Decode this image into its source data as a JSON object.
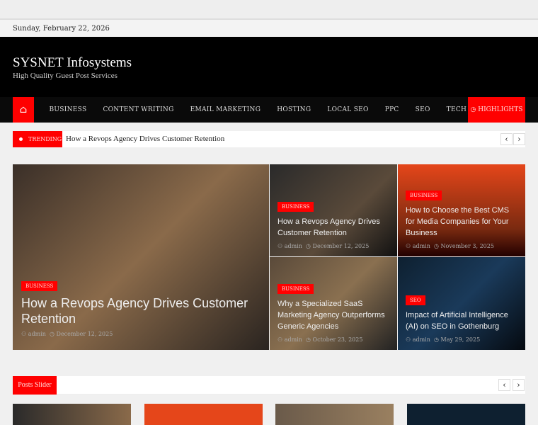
{
  "date": "Sunday, February 22, 2026",
  "site": {
    "title": "SYSNET Infosystems",
    "tagline": "High Quality Guest Post Services"
  },
  "nav": {
    "home_icon": "home-icon",
    "items": [
      "BUSINESS",
      "CONTENT WRITING",
      "EMAIL MARKETING",
      "HOSTING",
      "LOCAL SEO",
      "PPC",
      "SEO",
      "TECH"
    ],
    "highlights": "HIGHLIGHTS"
  },
  "trending": {
    "label": "TRENDING",
    "text": "How a Revops Agency Drives Customer Retention",
    "prev": "‹",
    "next": "›"
  },
  "featured": [
    {
      "cat": "BUSINESS",
      "title": "How a Revops Agency Drives Customer Retention",
      "author": "admin",
      "date": "December 12, 2025"
    },
    {
      "cat": "BUSINESS",
      "title": "How a Revops Agency Drives Customer Retention",
      "author": "admin",
      "date": "December 12, 2025"
    },
    {
      "cat": "BUSINESS",
      "title": "How to Choose the Best CMS for Media Companies for Your Business",
      "author": "admin",
      "date": "November 3, 2025"
    },
    {
      "cat": "BUSINESS",
      "title": "Why a Specialized SaaS Marketing Agency Outperforms Generic Agencies",
      "author": "admin",
      "date": "October 23, 2025"
    },
    {
      "cat": "SEO",
      "title": "Impact of Artificial Intelligence (AI) on SEO in Gothenburg",
      "author": "admin",
      "date": "May 29, 2025"
    }
  ],
  "slider": {
    "title": "Posts Slider",
    "prev": "‹",
    "next": "›"
  }
}
